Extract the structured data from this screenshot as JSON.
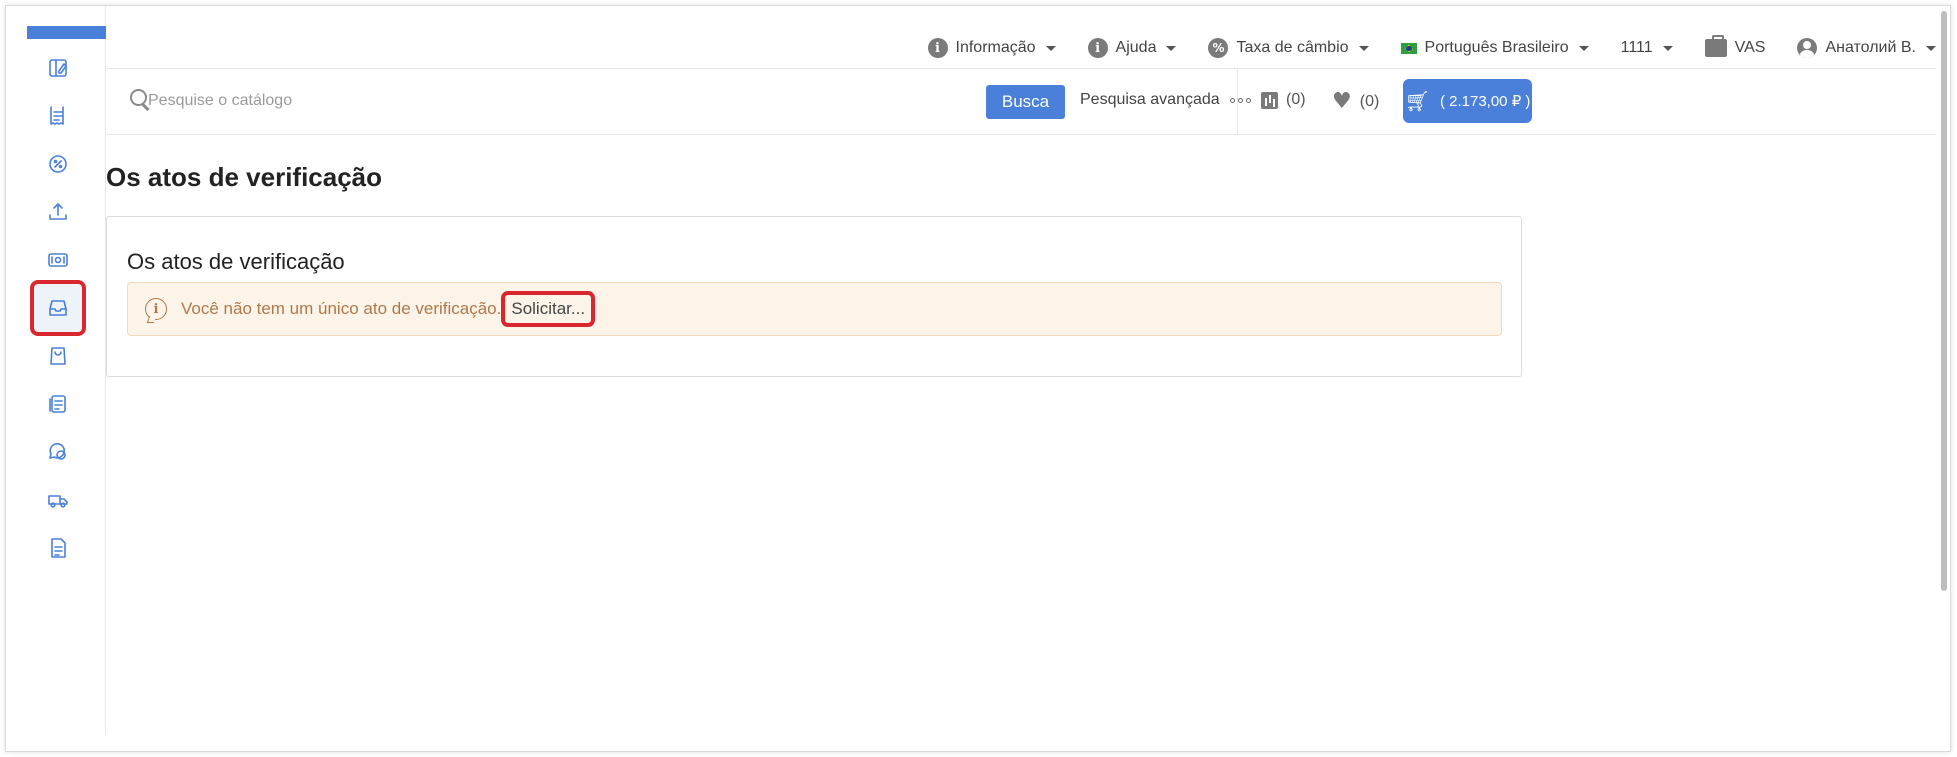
{
  "topbar": {
    "info_label": "Informação",
    "help_label": "Ajuda",
    "exchange_label": "Taxa de câmbio",
    "language_label": "Português Brasileiro",
    "account_code": "1111",
    "vas_label": "VAS",
    "user_name": "Анатолий В."
  },
  "search": {
    "placeholder": "Pesquise o catálogo",
    "button_label": "Busca",
    "advanced_label": "Pesquisa avançada",
    "compare_count": "(0)",
    "favorites_count": "(0)",
    "cart_total": "( 2.173,00 ₽ )"
  },
  "page": {
    "title": "Os atos de verificação",
    "panel_title": "Os atos de verificação",
    "alert_text": "Você não tem um único ato de verificação.",
    "alert_link": "Solicitar..."
  },
  "sidebar": {
    "items": [
      {
        "icon": "catalog-icon"
      },
      {
        "icon": "orders-icon"
      },
      {
        "icon": "discount-icon"
      },
      {
        "icon": "upload-icon"
      },
      {
        "icon": "money-icon"
      },
      {
        "icon": "inbox-icon",
        "active": true
      },
      {
        "icon": "bag-icon"
      },
      {
        "icon": "documents-icon"
      },
      {
        "icon": "chat-icon"
      },
      {
        "icon": "truck-icon"
      },
      {
        "icon": "file-icon"
      }
    ]
  },
  "colors": {
    "accent": "#4a80d9",
    "alert_bg": "#fdf4e9",
    "alert_text": "#b0784a",
    "highlight": "#d9272e"
  }
}
